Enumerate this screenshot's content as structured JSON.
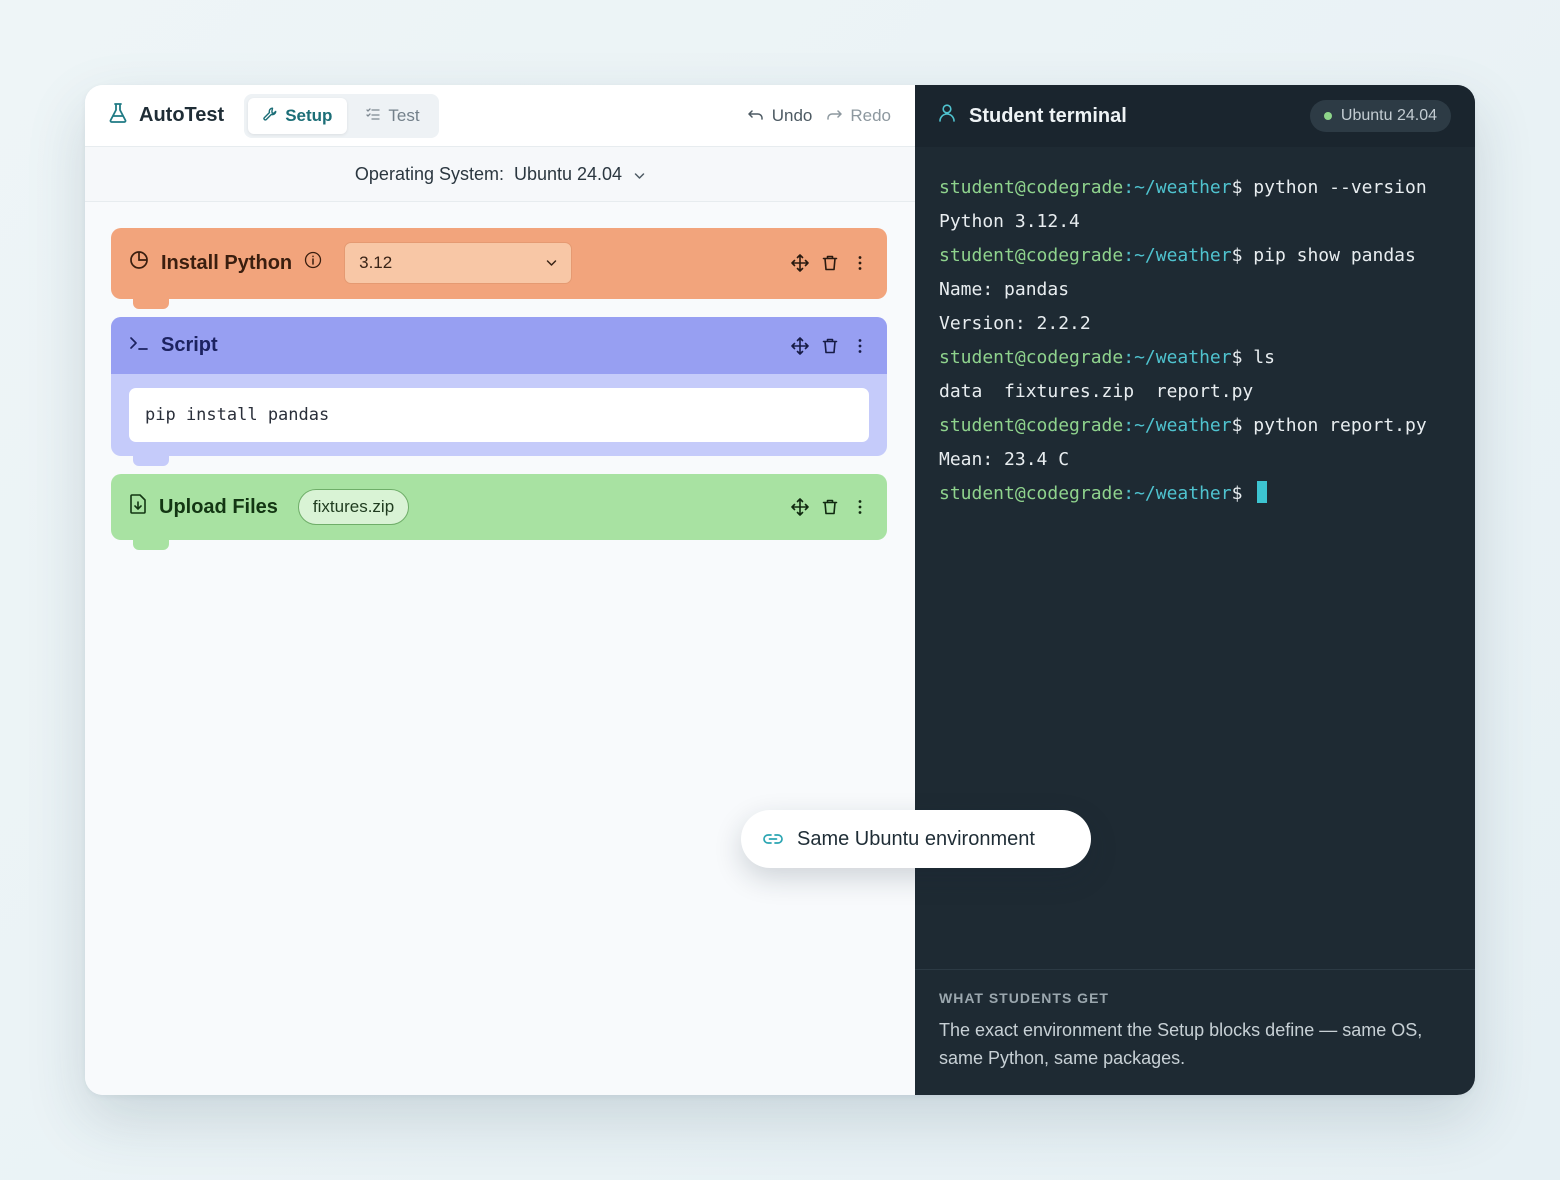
{
  "app": {
    "title": "AutoTest",
    "tabs": [
      {
        "label": "Setup",
        "icon": "wrench-icon",
        "active": true
      },
      {
        "label": "Test",
        "icon": "checklist-icon",
        "active": false
      }
    ],
    "undo_label": "Undo",
    "redo_label": "Redo"
  },
  "os_bar": {
    "label": "Operating System:",
    "value": "Ubuntu 24.04"
  },
  "blocks": {
    "install_python": {
      "title": "Install Python",
      "selected_version": "3.12",
      "color": "#f2a47c"
    },
    "script": {
      "title": "Script",
      "code": "pip install pandas",
      "color": "#979ff2"
    },
    "upload_files": {
      "title": "Upload Files",
      "file": "fixtures.zip",
      "color": "#a8e2a2"
    }
  },
  "terminal": {
    "title": "Student terminal",
    "os_badge": "Ubuntu 24.04",
    "prompt_user": "student@codegrade",
    "prompt_path": ":~/weather",
    "prompt_symbol": "$",
    "lines": [
      {
        "cmd": " python --version"
      },
      {
        "out": "Python 3.12.4"
      },
      {
        "cmd": " pip show pandas"
      },
      {
        "out": "Name: pandas"
      },
      {
        "out": "Version: 2.2.2"
      },
      {
        "cmd": " ls"
      },
      {
        "out": "data  fixtures.zip  report.py"
      },
      {
        "cmd": " python report.py"
      },
      {
        "out": "Mean: 23.4 C"
      },
      {
        "cmd": " "
      }
    ]
  },
  "info": {
    "kicker": "WHAT STUDENTS GET",
    "description": "The exact environment the Setup blocks define — same OS, same Python, same packages."
  },
  "pill": {
    "label": "Same Ubuntu environment"
  }
}
